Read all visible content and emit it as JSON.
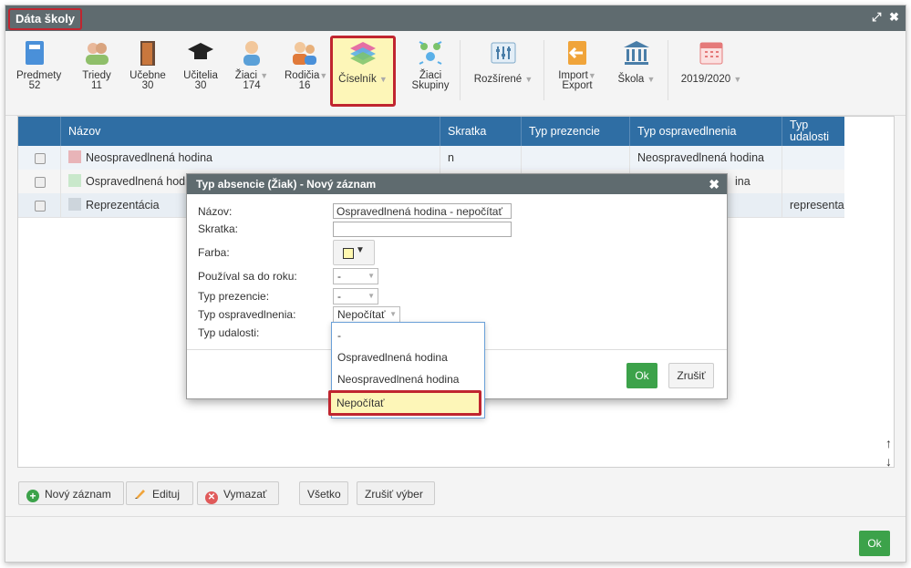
{
  "window": {
    "title": "Dáta školy",
    "resize_icon": "⤢",
    "close_icon": "✖"
  },
  "toolbar": {
    "items": [
      {
        "label": "Predmety",
        "sub": "52"
      },
      {
        "label": "Triedy",
        "sub": "11"
      },
      {
        "label": "Učebne",
        "sub": "30"
      },
      {
        "label": "Učitelia",
        "sub": "30"
      },
      {
        "label": "Žiaci",
        "sub": "174"
      },
      {
        "label": "Rodičia",
        "sub": "16"
      },
      {
        "label": "Číselník",
        "sub": ""
      },
      {
        "label": "Žiaci",
        "sub": "Skupiny"
      },
      {
        "label": "Rozšírené",
        "sub": ""
      },
      {
        "label": "Import",
        "sub": "Export"
      },
      {
        "label": "Škola",
        "sub": ""
      },
      {
        "label": "2019/2020",
        "sub": ""
      }
    ],
    "dropdown_arrow": "▼"
  },
  "grid": {
    "columns": [
      "Názov",
      "Skratka",
      "Typ prezencie",
      "Typ ospravedlnenia",
      "Typ udalosti"
    ],
    "rows": [
      {
        "name": "Neospravedlnená hodina",
        "abbr": "n",
        "presence": "",
        "excuse": "Neospravedlnená hodina",
        "event": "",
        "color": "#e8b4b8"
      },
      {
        "name": "Ospravedlnená hodina",
        "abbr": "",
        "presence": "",
        "excuse": "ina",
        "event": "",
        "color": "#c9e8cb"
      },
      {
        "name": "Reprezentácia",
        "abbr": "",
        "presence": "",
        "excuse": "",
        "event": "representat",
        "color": "#cdd5dc"
      }
    ],
    "scroll_up": "↑",
    "scroll_down": "↓"
  },
  "actions": {
    "new": "Nový záznam",
    "edit": "Edituj",
    "delete": "Vymazať",
    "all": "Všetko",
    "clear": "Zrušiť výber"
  },
  "footer": {
    "ok": "Ok"
  },
  "dialog": {
    "title": "Typ absencie (Žiak) - Nový záznam",
    "close": "✖",
    "fields": {
      "name_label": "Názov:",
      "name_value": "Ospravedlnená hodina - nepočítať",
      "abbr_label": "Skratka:",
      "abbr_value": "",
      "color_label": "Farba:",
      "used_label": "Používal sa do roku:",
      "used_value": "-",
      "presence_label": "Typ prezencie:",
      "presence_value": "-",
      "excuse_label": "Typ ospravedlnenia:",
      "excuse_value": "Nepočítať",
      "event_label": "Typ udalosti:"
    },
    "ok": "Ok",
    "cancel": "Zrušiť"
  },
  "dropdown": {
    "options": [
      "-",
      "Ospravedlnená hodina",
      "Neospravedlnená hodina",
      "Nepočítať"
    ],
    "selected": "Nepočítať"
  },
  "colors": {
    "titlebar": "#5f6b6f",
    "grid_header": "#2f6ea4",
    "highlight_border": "#c0252f",
    "ok_green": "#3ca24a"
  }
}
